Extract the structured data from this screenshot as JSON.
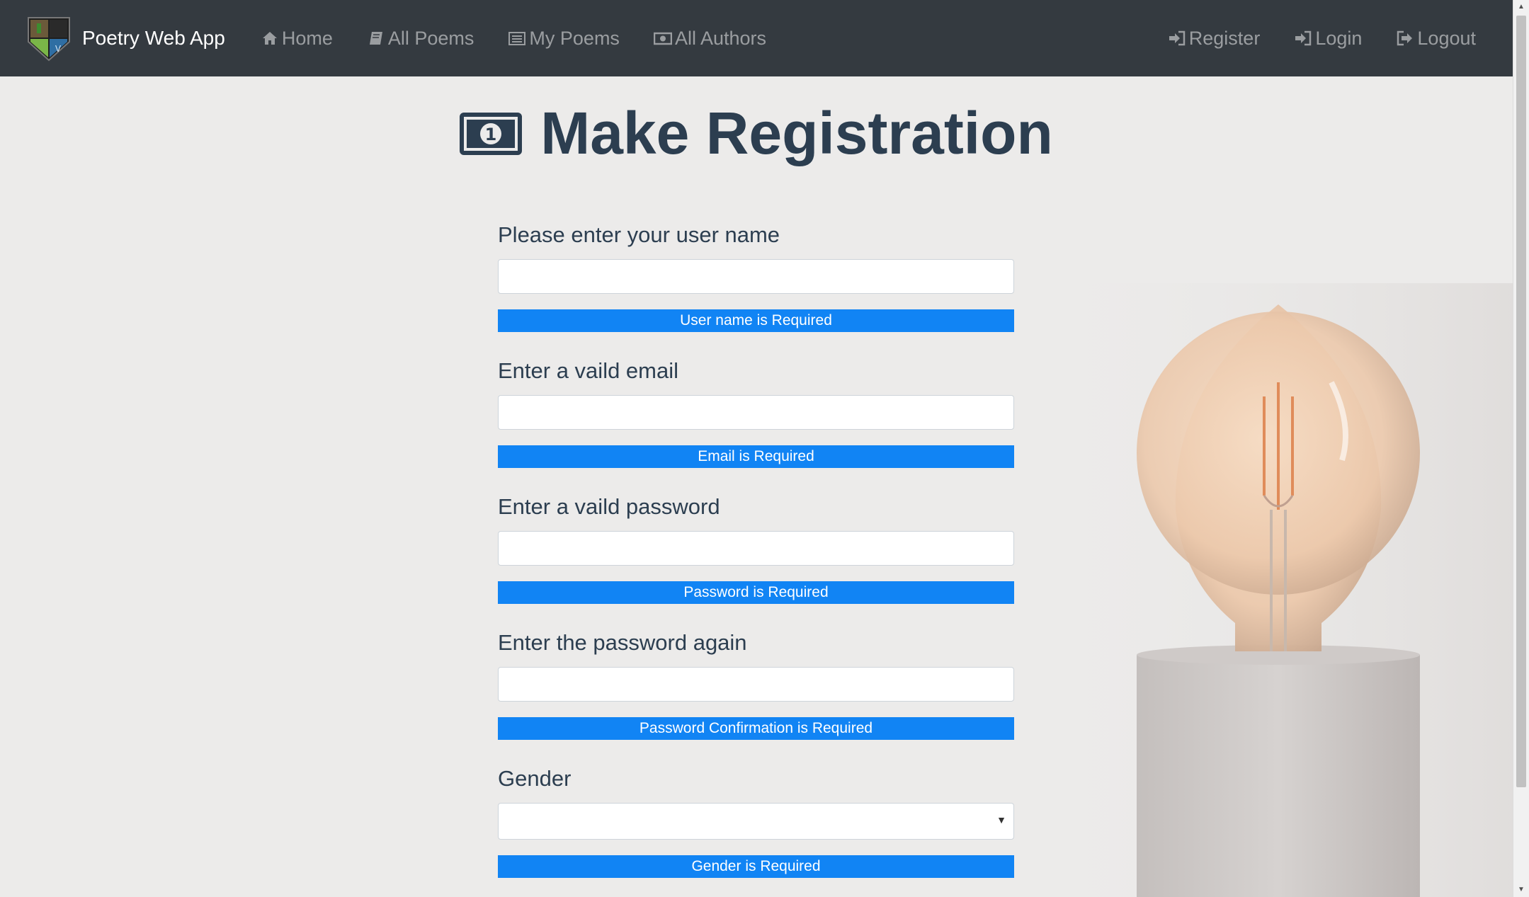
{
  "nav": {
    "brand": "Poetry Web App",
    "left_links": [
      {
        "label": "Home",
        "icon": "home-icon"
      },
      {
        "label": "All Poems",
        "icon": "book-icon"
      },
      {
        "label": "My Poems",
        "icon": "list-icon"
      },
      {
        "label": "All Authors",
        "icon": "money-icon"
      }
    ],
    "right_links": [
      {
        "label": "Register",
        "icon": "sign-in-icon"
      },
      {
        "label": "Login",
        "icon": "sign-in-icon"
      },
      {
        "label": "Logout",
        "icon": "sign-out-icon"
      }
    ],
    "background_color": "#343a40"
  },
  "page": {
    "title": "Make Registration",
    "title_icon": "money-bill-icon"
  },
  "form": {
    "username": {
      "label": "Please enter your user name",
      "value": "",
      "error": "User name is Required"
    },
    "email": {
      "label": "Enter a vaild email",
      "value": "",
      "error": "Email is Required"
    },
    "password": {
      "label": "Enter a vaild password",
      "value": "",
      "error": "Password is Required"
    },
    "password_confirm": {
      "label": "Enter the password again",
      "value": "",
      "error": "Password Confirmation is Required"
    },
    "gender": {
      "label": "Gender",
      "selected": "",
      "error": "Gender is Required"
    }
  },
  "colors": {
    "error_badge": "#1184f4",
    "heading_text": "#2c3e50",
    "page_background": "#ecebea"
  }
}
